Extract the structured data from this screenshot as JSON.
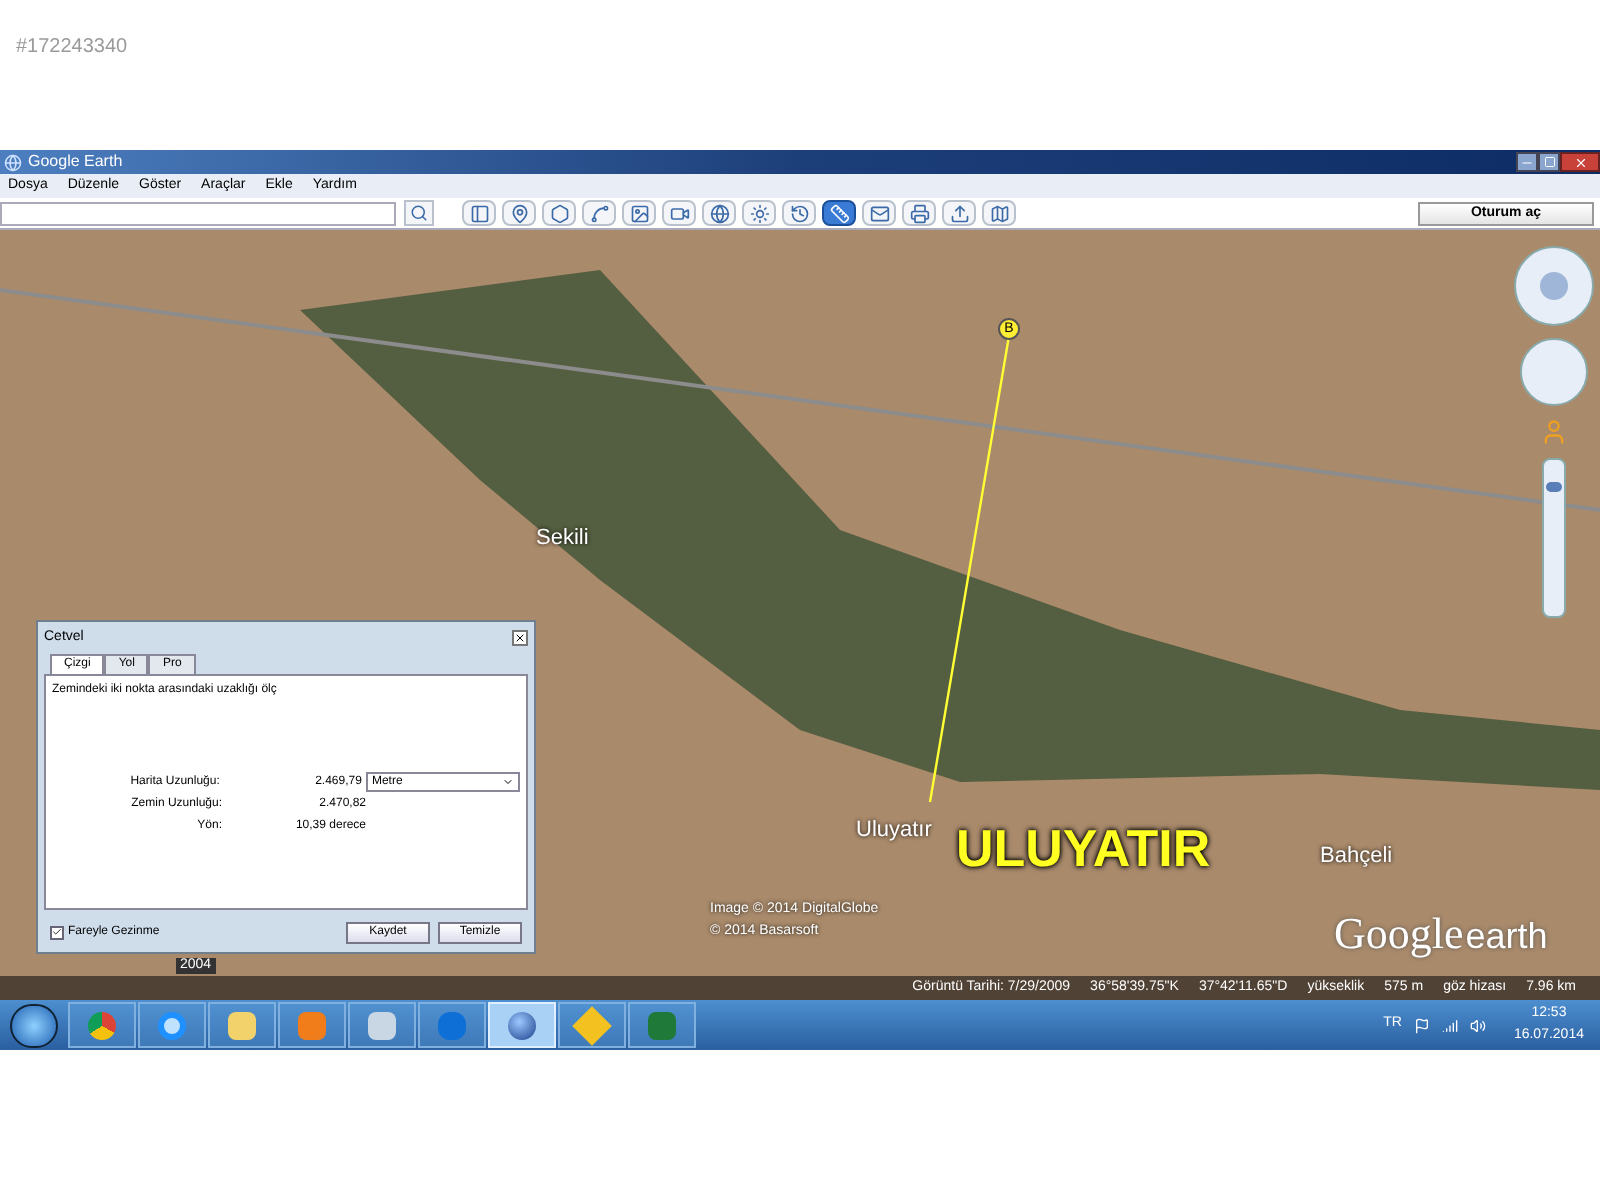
{
  "listing_id": "#172243340",
  "window": {
    "title": "Google Earth"
  },
  "menu": [
    "Dosya",
    "Düzenle",
    "Göster",
    "Araçlar",
    "Ekle",
    "Yardım"
  ],
  "toolbar": {
    "tools": [
      {
        "kind": "sidebar",
        "selected": false
      },
      {
        "kind": "placemark",
        "selected": false
      },
      {
        "kind": "polygon",
        "selected": false
      },
      {
        "kind": "path",
        "selected": false
      },
      {
        "kind": "overlay",
        "selected": false
      },
      {
        "kind": "tour",
        "selected": false
      },
      {
        "kind": "planet",
        "selected": false
      },
      {
        "kind": "sun",
        "selected": false
      },
      {
        "kind": "history",
        "selected": false
      },
      {
        "kind": "ruler",
        "selected": true
      },
      {
        "kind": "email",
        "selected": false
      },
      {
        "kind": "print",
        "selected": false
      },
      {
        "kind": "save",
        "selected": false
      },
      {
        "kind": "maps",
        "selected": false
      }
    ],
    "sign_in": "Oturum aç"
  },
  "map": {
    "labels": [
      {
        "kind": "town",
        "text": "Sekili"
      },
      {
        "kind": "town",
        "text": "Uluyatır"
      },
      {
        "kind": "big",
        "text": "ULUYATIR"
      },
      {
        "kind": "town",
        "text": "Bahçeli"
      }
    ],
    "marker": "B",
    "zoom": {
      "level": 0.85
    },
    "year": "2004",
    "credits": [
      "Image © 2014 DigitalGlobe",
      "© 2014 Basarsoft"
    ],
    "logo": [
      "Google",
      "earth"
    ],
    "status": [
      "Görüntü Tarihi: 7/29/2009",
      "36°58'39.75\"K",
      "37°42'11.65\"D",
      "yükseklik",
      "575 m",
      "göz hizası",
      "7.96 km"
    ]
  },
  "ruler_dialog": {
    "title": "Cetvel",
    "tabs": [
      {
        "label": "Çizgi",
        "selected": true
      },
      {
        "label": "Yol",
        "selected": false
      },
      {
        "label": "Pro",
        "selected": false
      }
    ],
    "instruction": "Zemindeki iki nokta arasındaki uzaklığı ölç",
    "rows": [
      {
        "label": "Harita Uzunluğu:",
        "value": "2.469,79",
        "unit_select": "Metre"
      },
      {
        "label": "Zemin Uzunluğu:",
        "value": "2.470,82"
      },
      {
        "label": "Yön:",
        "value": "10,39 derece"
      }
    ],
    "mouse_nav": {
      "label": "Fareyle Gezinme",
      "checked": true
    },
    "buttons": [
      "Kaydet",
      "Temizle"
    ]
  },
  "taskbar": {
    "apps": [
      {
        "kind": "chrome",
        "selected": false
      },
      {
        "kind": "ie",
        "selected": false
      },
      {
        "kind": "folder",
        "selected": false
      },
      {
        "kind": "media",
        "selected": false
      },
      {
        "kind": "calculator",
        "selected": false
      },
      {
        "kind": "teamviewer",
        "selected": false
      },
      {
        "kind": "earth",
        "selected": true
      },
      {
        "kind": "arrows",
        "selected": false
      },
      {
        "kind": "excel",
        "selected": false
      }
    ],
    "language": "TR",
    "time": "12:53",
    "date": "16.07.2014"
  }
}
